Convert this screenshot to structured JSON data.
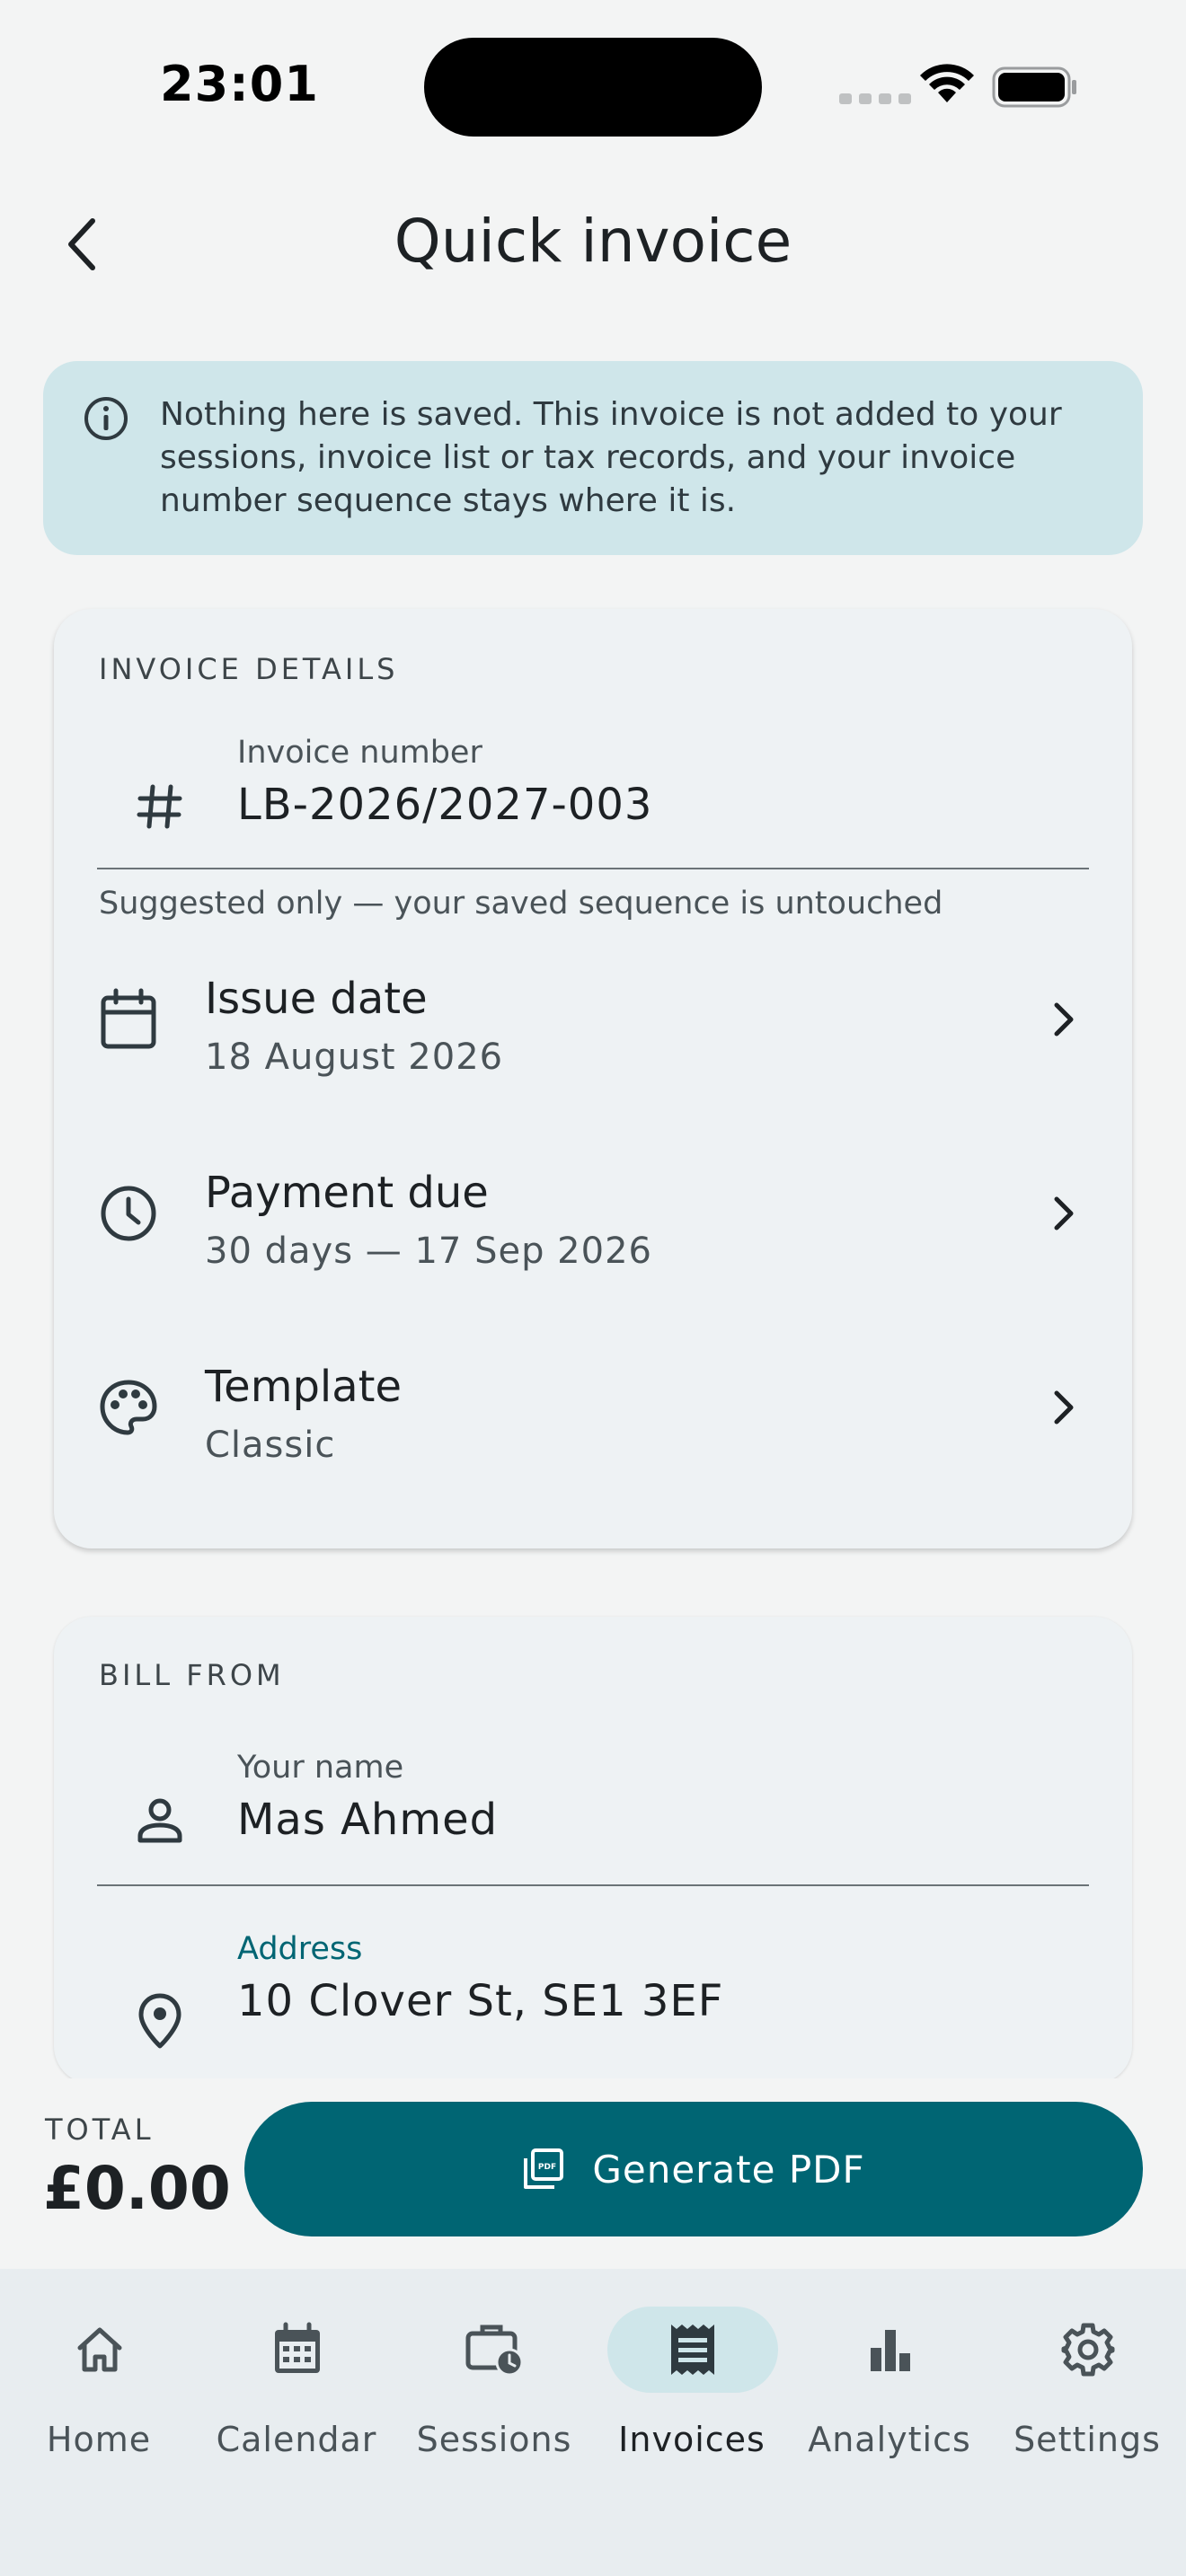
{
  "status_bar": {
    "time": "23:01"
  },
  "header": {
    "title": "Quick invoice"
  },
  "info_banner": {
    "text": "Nothing here is saved. This invoice is not added to your sessions, invoice list or tax records, and your invoice number sequence stays where it is."
  },
  "invoice_details": {
    "section_title": "INVOICE DETAILS",
    "invoice_number": {
      "label": "Invoice number",
      "value": "LB-2026/2027-003"
    },
    "helper": "Suggested only — your saved sequence is untouched",
    "issue_date": {
      "title": "Issue date",
      "value": "18 August 2026"
    },
    "payment_due": {
      "title": "Payment due",
      "value": "30 days — 17 Sep 2026"
    },
    "template": {
      "title": "Template",
      "value": "Classic"
    }
  },
  "bill_from": {
    "section_title": "BILL FROM",
    "name": {
      "label": "Your name",
      "value": "Mas Ahmed"
    },
    "address": {
      "label": "Address",
      "value": "10 Clover St, SE1 3EF"
    }
  },
  "footer": {
    "total_label": "TOTAL",
    "total_value": "£0.00",
    "generate_label": "Generate PDF"
  },
  "nav": {
    "items": [
      {
        "label": "Home",
        "icon": "home-icon"
      },
      {
        "label": "Calendar",
        "icon": "calendar-icon"
      },
      {
        "label": "Sessions",
        "icon": "sessions-icon"
      },
      {
        "label": "Invoices",
        "icon": "invoice-icon",
        "active": true
      },
      {
        "label": "Analytics",
        "icon": "analytics-icon"
      },
      {
        "label": "Settings",
        "icon": "gear-icon"
      }
    ]
  },
  "colors": {
    "accent": "#006573",
    "banner_bg": "#cfe6ea",
    "address_label": "#006573"
  }
}
